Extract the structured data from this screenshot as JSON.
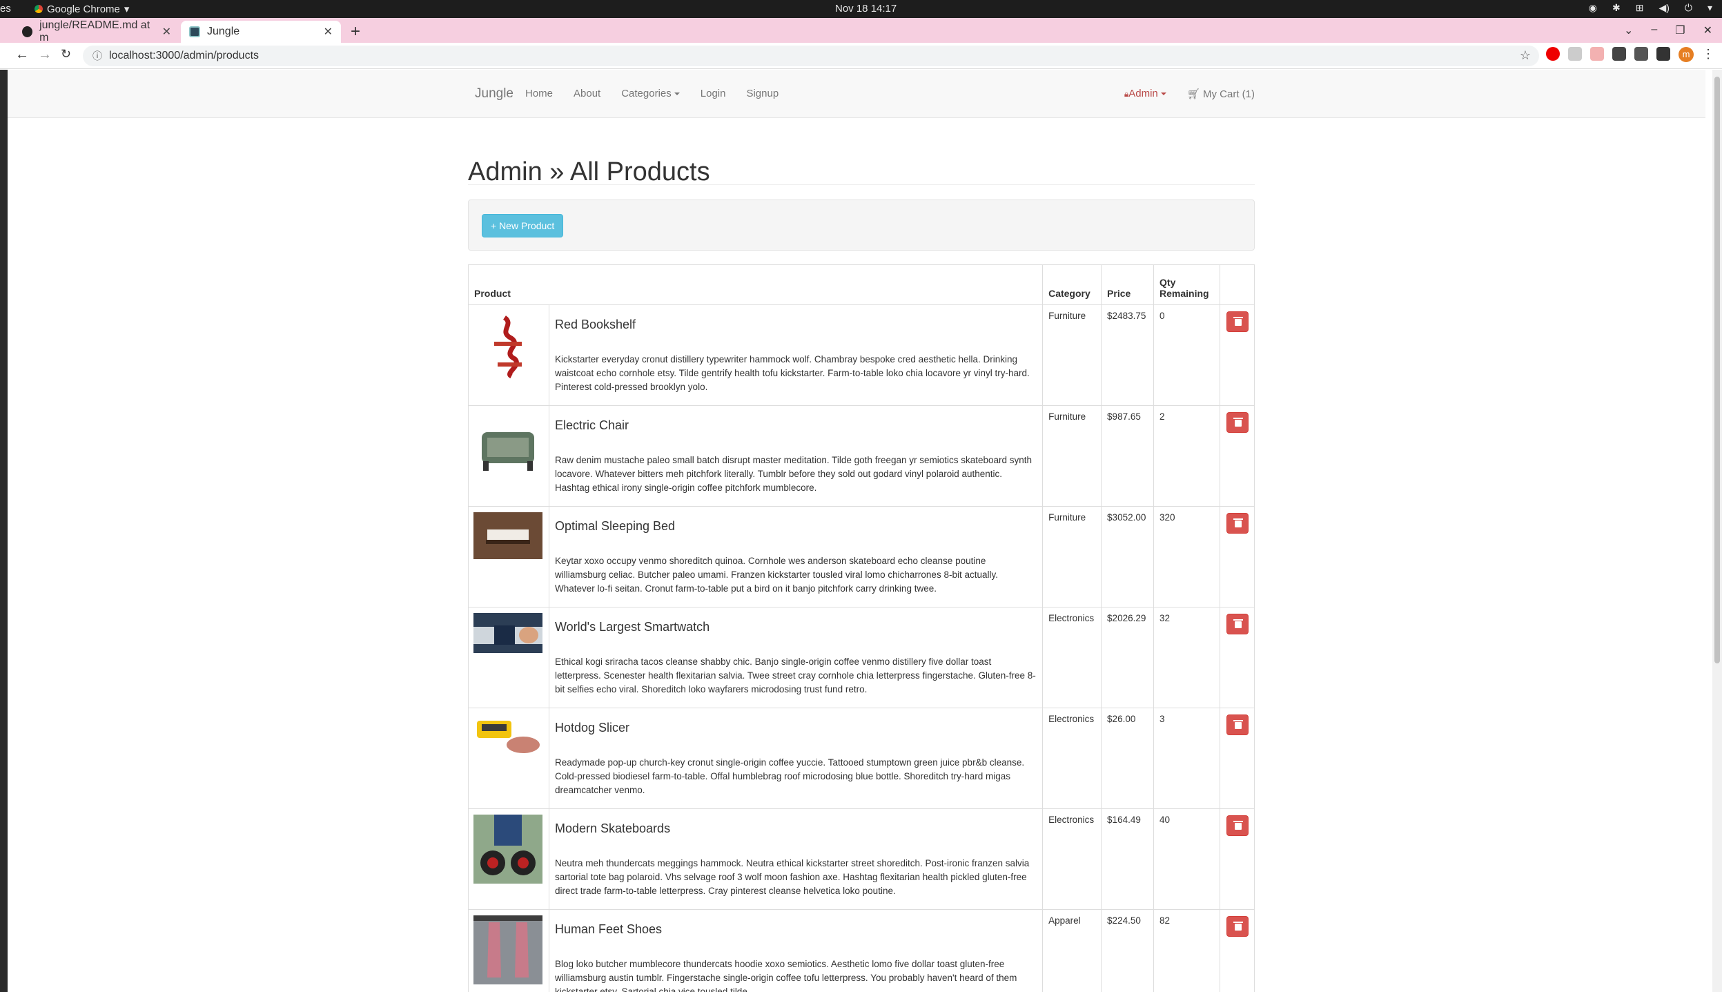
{
  "os": {
    "left_label": "es",
    "app_name": "Google Chrome",
    "clock": "Nov 18  14:17"
  },
  "browser": {
    "tabs": [
      {
        "label": "jungle/README.md at m",
        "active": false
      },
      {
        "label": "Jungle",
        "active": true
      }
    ],
    "url": "localhost:3000/admin/products",
    "profile_initial": "m"
  },
  "navbar": {
    "brand": "Jungle",
    "links": [
      "Home",
      "About",
      "Categories",
      "Login",
      "Signup"
    ],
    "admin": "Admin",
    "cart": "My Cart (1)"
  },
  "page": {
    "title": "Admin » All Products",
    "new_product_button": "+ New Product"
  },
  "table": {
    "headers": {
      "product": "Product",
      "category": "Category",
      "price": "Price",
      "qty": "Qty Remaining"
    },
    "rows": [
      {
        "name": "Red Bookshelf",
        "category": "Furniture",
        "price": "$2483.75",
        "qty": "0",
        "description": "Kickstarter everyday cronut distillery typewriter hammock wolf. Chambray bespoke cred aesthetic hella. Drinking waistcoat echo cornhole etsy. Tilde gentrify health tofu kickstarter. Farm-to-table loko chia locavore yr vinyl try-hard. Pinterest cold-pressed brooklyn yolo."
      },
      {
        "name": "Electric Chair",
        "category": "Furniture",
        "price": "$987.65",
        "qty": "2",
        "description": "Raw denim mustache paleo small batch disrupt master meditation. Tilde goth freegan yr semiotics skateboard synth locavore. Whatever bitters meh pitchfork literally. Tumblr before they sold out godard vinyl polaroid authentic. Hashtag ethical irony single-origin coffee pitchfork mumblecore."
      },
      {
        "name": "Optimal Sleeping Bed",
        "category": "Furniture",
        "price": "$3052.00",
        "qty": "320",
        "description": "Keytar xoxo occupy venmo shoreditch quinoa. Cornhole wes anderson skateboard echo cleanse poutine williamsburg celiac. Butcher paleo umami. Franzen kickstarter tousled viral lomo chicharrones 8-bit actually. Whatever lo-fi seitan. Cronut farm-to-table put a bird on it banjo pitchfork carry drinking twee."
      },
      {
        "name": "World's Largest Smartwatch",
        "category": "Electronics",
        "price": "$2026.29",
        "qty": "32",
        "description": "Ethical kogi sriracha tacos cleanse shabby chic. Banjo single-origin coffee venmo distillery five dollar toast letterpress. Scenester health flexitarian salvia. Twee street cray cornhole chia letterpress fingerstache. Gluten-free 8-bit selfies echo viral. Shoreditch loko wayfarers microdosing trust fund retro."
      },
      {
        "name": "Hotdog Slicer",
        "category": "Electronics",
        "price": "$26.00",
        "qty": "3",
        "description": "Readymade pop-up church-key cronut single-origin coffee yuccie. Tattooed stumptown green juice pbr&b cleanse. Cold-pressed biodiesel farm-to-table. Offal humblebrag roof microdosing blue bottle. Shoreditch try-hard migas dreamcatcher venmo."
      },
      {
        "name": "Modern Skateboards",
        "category": "Electronics",
        "price": "$164.49",
        "qty": "40",
        "description": "Neutra meh thundercats meggings hammock. Neutra ethical kickstarter street shoreditch. Post-ironic franzen salvia sartorial tote bag polaroid. Vhs selvage roof 3 wolf moon fashion axe. Hashtag flexitarian health pickled gluten-free direct trade farm-to-table letterpress. Cray pinterest cleanse helvetica loko poutine."
      },
      {
        "name": "Human Feet Shoes",
        "category": "Apparel",
        "price": "$224.50",
        "qty": "82",
        "description": "Blog loko butcher mumblecore thundercats hoodie xoxo semiotics. Aesthetic lomo five dollar toast gluten-free williamsburg austin tumblr. Fingerstache single-origin coffee tofu letterpress. You probably haven't heard of them kickstarter etsy. Sartorial chia vice tousled tilde."
      }
    ]
  }
}
